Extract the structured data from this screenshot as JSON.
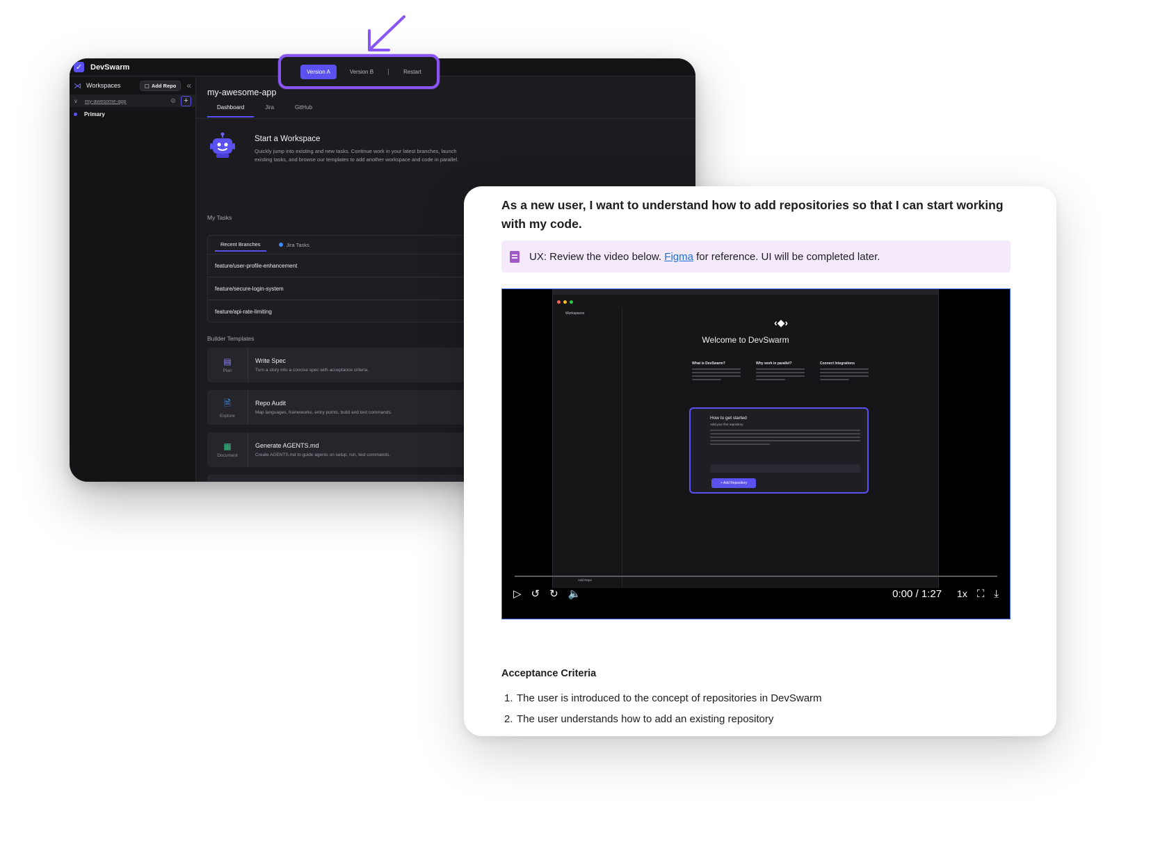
{
  "app": {
    "title": "DevSwarm",
    "logo_icon": "check-icon"
  },
  "sidebar": {
    "workspaces_label": "Workspaces",
    "add_repo_label": "Add Repo",
    "repo_name": "my-awesome-app",
    "workspace_item": "Primary"
  },
  "version_selector": {
    "version_a": "Version A",
    "version_b": "Version B",
    "separator": "|",
    "restart": "Restart",
    "selected": "Version A",
    "accent_color": "#8a55f5"
  },
  "main": {
    "repo_title": "my-awesome-app",
    "tabs": [
      {
        "label": "Dashboard",
        "active": true
      },
      {
        "label": "Jira",
        "active": false
      },
      {
        "label": "GitHub",
        "active": false
      }
    ],
    "workspace_card": {
      "title": "Start a Workspace",
      "description": "Quickly jump into existing and new tasks. Continue work in your latest branches, launch existing tasks, and browse our templates to add another workspace and code in parallel."
    },
    "my_tasks_label": "My Tasks",
    "task_tabs": [
      {
        "label": "Recent Branches",
        "active": true
      },
      {
        "label": "Jira Tasks",
        "active": false
      }
    ],
    "branches": [
      "feature/user-profile-enhancement",
      "feature/secure-login-system",
      "feature/api-rate-limiting"
    ],
    "builder_templates_label": "Builder Templates",
    "templates": [
      {
        "category": "Plan",
        "title": "Write Spec",
        "description": "Turn a story into a concise spec with acceptance criteria.",
        "icon": "clipboard-icon",
        "icon_color": "#8f86ff"
      },
      {
        "category": "Explore",
        "title": "Repo Audit",
        "description": "Map languages, frameworks, entry points, build and test commands.",
        "icon": "document-icon",
        "icon_color": "#4aa3ff"
      },
      {
        "category": "Document",
        "title": "Generate AGENTS.md",
        "description": "Create AGENTS.md to guide agents on setup, run, test commands.",
        "icon": "table-icon",
        "icon_color": "#38c98a"
      }
    ],
    "brand_color": "#5b50f0"
  },
  "story": {
    "heading": "As a new user, I want to understand how to add repositories so that I can start working with my code.",
    "callout": {
      "prefix": "UX: Review the video below. ",
      "link": "Figma",
      "suffix": " for reference. UI will be completed later.",
      "background": "#f5eafc"
    },
    "video": {
      "inner_title": "Welcome to DevSwarm",
      "inner_sidebar": "Workspaces",
      "inner_columns": [
        "What is DevSwarm?",
        "Why work in parallel?",
        "Connect Integrations"
      ],
      "modal_title": "How to get started",
      "modal_subtitle": "Add your first repository",
      "modal_button": "+ Add Repository",
      "inner_add_repo": "Add Repo",
      "time": "0:00 / 1:27",
      "speed": "1x"
    },
    "acceptance_title": "Acceptance Criteria",
    "acceptance_items": [
      "The user is introduced to the concept of repositories in DevSwarm",
      "The user understands how to add an existing repository"
    ]
  }
}
